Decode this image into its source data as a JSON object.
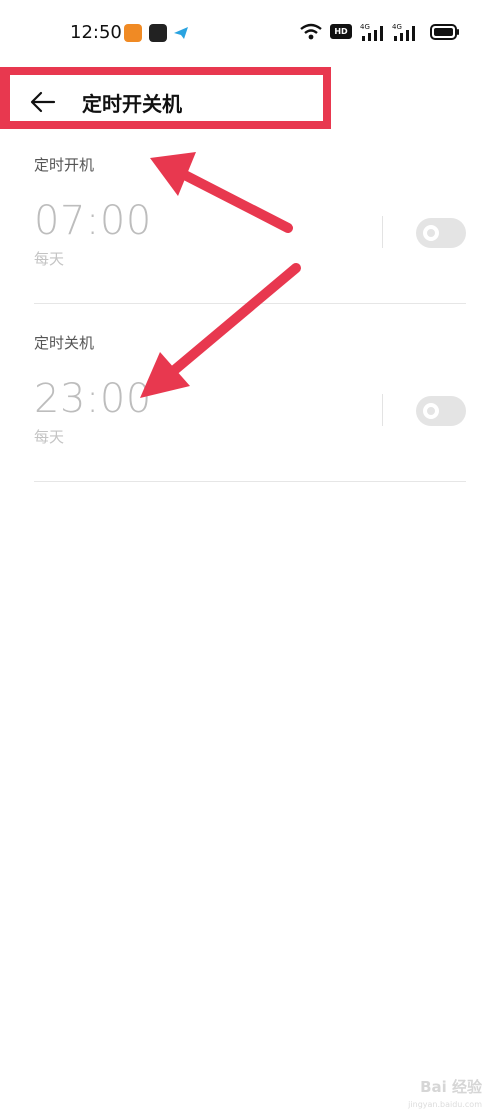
{
  "status_bar": {
    "time": "12:50",
    "icons": [
      "uc-browser-icon",
      "sohu-app-icon",
      "telegram-icon",
      "wifi-icon",
      "hd-icon",
      "signal-4g-icon",
      "signal-4g-icon",
      "battery-icon"
    ],
    "hd_text": "HD"
  },
  "header": {
    "back_icon": "arrow-left-icon",
    "title": "定时开关机"
  },
  "schedules": [
    {
      "label": "定时开机",
      "time": "07:00",
      "repeat": "每天",
      "enabled": false
    },
    {
      "label": "定时关机",
      "time": "23:00",
      "repeat": "每天",
      "enabled": false
    }
  ],
  "colors": {
    "annotation": "#e8384f",
    "toggle_off": "#e4e4e4",
    "time_text": "#bdbdbd"
  },
  "watermark": {
    "text": "Bai 经验",
    "sub": "jingyan.baidu.com"
  }
}
